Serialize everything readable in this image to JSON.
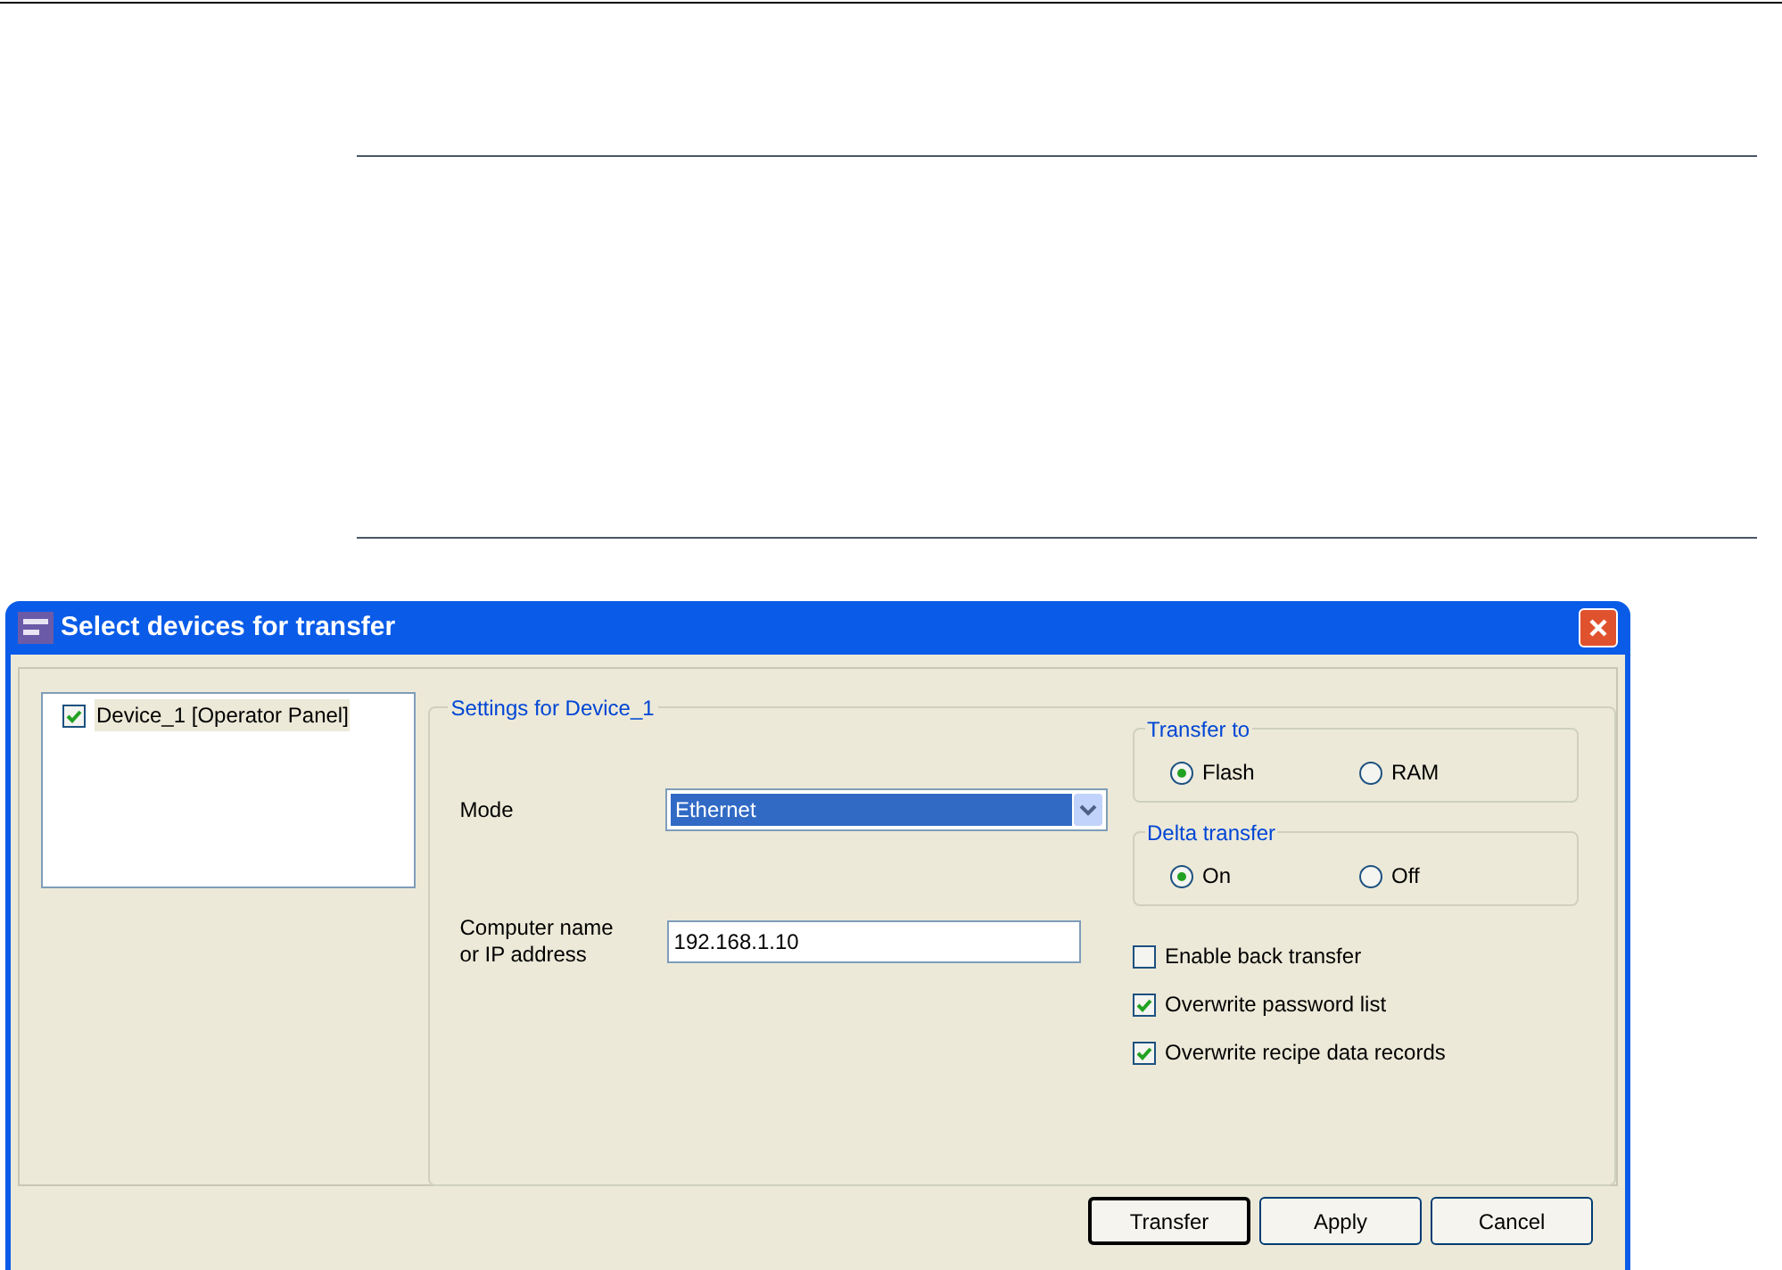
{
  "window": {
    "title": "Select devices for transfer"
  },
  "devices": [
    {
      "label": "Device_1 [Operator Panel]",
      "checked": true,
      "selected": true
    }
  ],
  "settings": {
    "title": "Settings for Device_1",
    "mode": {
      "label": "Mode",
      "value": "Ethernet"
    },
    "address": {
      "label": "Computer name or IP address",
      "value": "192.168.1.10"
    },
    "transfer_to": {
      "title": "Transfer to",
      "options": [
        {
          "label": "Flash",
          "selected": true
        },
        {
          "label": "RAM",
          "selected": false
        }
      ]
    },
    "delta_transfer": {
      "title": "Delta transfer",
      "options": [
        {
          "label": "On",
          "selected": true
        },
        {
          "label": "Off",
          "selected": false
        }
      ]
    },
    "options": [
      {
        "label": "Enable back transfer",
        "checked": false
      },
      {
        "label": "Overwrite password list",
        "checked": true
      },
      {
        "label": "Overwrite recipe data records",
        "checked": true
      }
    ]
  },
  "buttons": [
    {
      "label": "Transfer",
      "default": true
    },
    {
      "label": "Apply",
      "default": false
    },
    {
      "label": "Cancel",
      "default": false
    }
  ]
}
